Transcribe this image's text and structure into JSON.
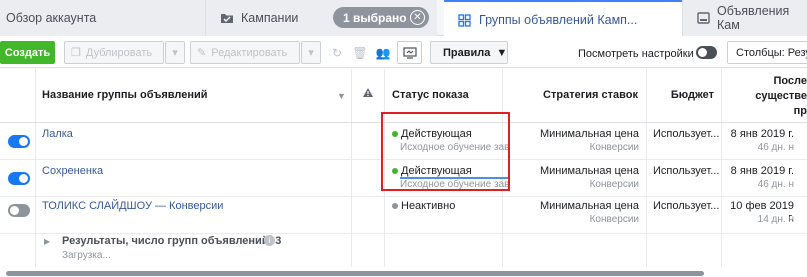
{
  "tabs": {
    "overview": "Обзор аккаунта",
    "campaigns": "Кампании",
    "selected_badge": "1 выбрано",
    "adsets": "Группы объявлений Камп...",
    "ads": "Объявления Кам"
  },
  "toolbar": {
    "create": "Создать",
    "duplicate": "Дублировать",
    "edit": "Редактировать",
    "rules": "Правила",
    "view_settings": "Посмотреть настройки",
    "columns": "Столбцы: Резу"
  },
  "table": {
    "headers": {
      "name": "Название группы объявлений",
      "status": "Статус показа",
      "strategy": "Стратегия ставок",
      "budget": "Бюджет",
      "last_line1": "После",
      "last_line2": "существе",
      "last_line3": "пр"
    },
    "rows": [
      {
        "name": "Лалка",
        "status": "Действующая",
        "status_sub": "Исходное обучение зав",
        "strategy": "Минимальная цена",
        "strategy_sub": "Конверсии",
        "budget": "Использует...",
        "date": "8 янв 2019 г.",
        "date_sub": "46 дн. н"
      },
      {
        "name": "Сохрененка",
        "status": "Действующая",
        "status_sub": "Исходное обучение зав",
        "strategy": "Минимальная цена",
        "strategy_sub": "Конверсии",
        "budget": "Использует...",
        "date": "8 янв 2019 г.",
        "date_sub": "46 дн. н"
      },
      {
        "name": "ТОЛИКС СЛАЙДШОУ — Конверсии",
        "status": "Неактивно",
        "status_sub": "",
        "strategy": "Минимальная цена",
        "strategy_sub": "Конверсии",
        "budget": "Использует...",
        "date": "10 фев 2019 г.",
        "date_sub": "14 дн. н"
      }
    ],
    "summary": "Результаты, число групп объявлений: 3",
    "loading": "Загрузка..."
  },
  "colors": {
    "accent_blue": "#1877f2",
    "link_blue": "#365899",
    "create_green": "#42b72a",
    "highlight_red": "#e02020",
    "active_green": "#42b72a"
  }
}
